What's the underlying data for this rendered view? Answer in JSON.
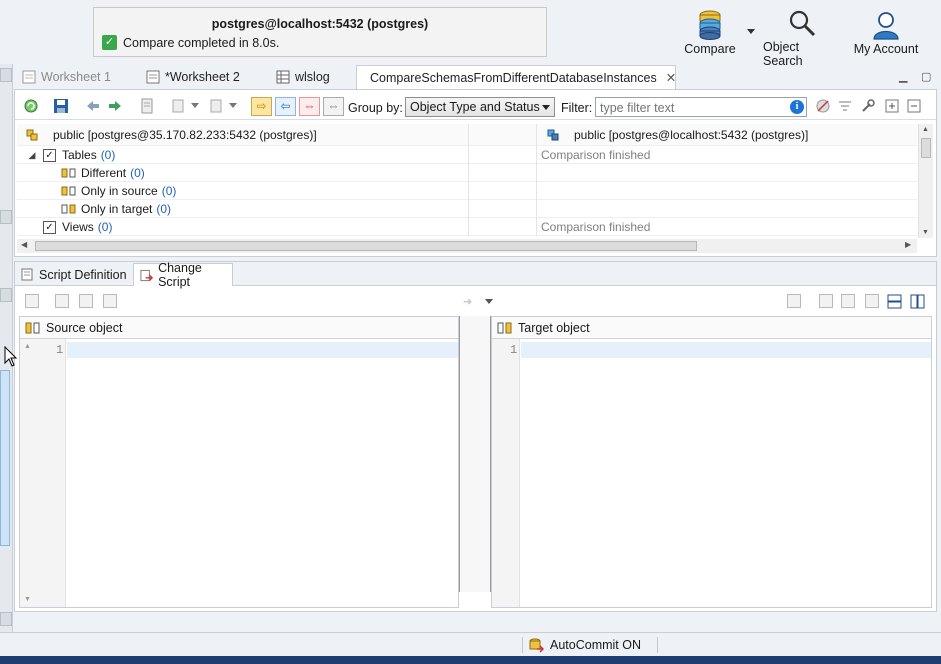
{
  "notification": {
    "title": "postgres@localhost:5432 (postgres)",
    "message": "Compare completed in 8.0s."
  },
  "top_toolbar": {
    "compare_label": "Compare",
    "object_search_label": "Object Search",
    "my_account_label": "My Account"
  },
  "tabs": [
    {
      "label": "Worksheet 1"
    },
    {
      "label": "*Worksheet 2"
    },
    {
      "label": "wlslog"
    },
    {
      "label": "CompareSchemasFromDifferentDatabaseInstances"
    }
  ],
  "compare_toolbar": {
    "group_by_label": "Group by:",
    "group_by_value": "Object Type and Status",
    "filter_label": "Filter:",
    "filter_placeholder": "type filter text"
  },
  "comparison": {
    "source_header": "public [postgres@35.170.82.233:5432 (postgres)]",
    "target_header": "public [postgres@localhost:5432 (postgres)]",
    "rows": [
      {
        "label": "Tables",
        "count": "(0)",
        "status": "Comparison finished"
      },
      {
        "label": "Different",
        "count": "(0)",
        "status": ""
      },
      {
        "label": "Only in source",
        "count": "(0)",
        "status": ""
      },
      {
        "label": "Only in target",
        "count": "(0)",
        "status": ""
      },
      {
        "label": "Views",
        "count": "(0)",
        "status": "Comparison finished"
      }
    ]
  },
  "lower_tabs": [
    {
      "label": "Script Definition"
    },
    {
      "label": "Change Script"
    }
  ],
  "panes": {
    "source_title": "Source object",
    "target_title": "Target object",
    "line_number": "1"
  },
  "statusbar": {
    "autocommit": "AutoCommit ON"
  },
  "colors": {
    "accent": "#2063b5",
    "check_green": "#39a84d",
    "highlight_line": "#e6f0fb"
  }
}
